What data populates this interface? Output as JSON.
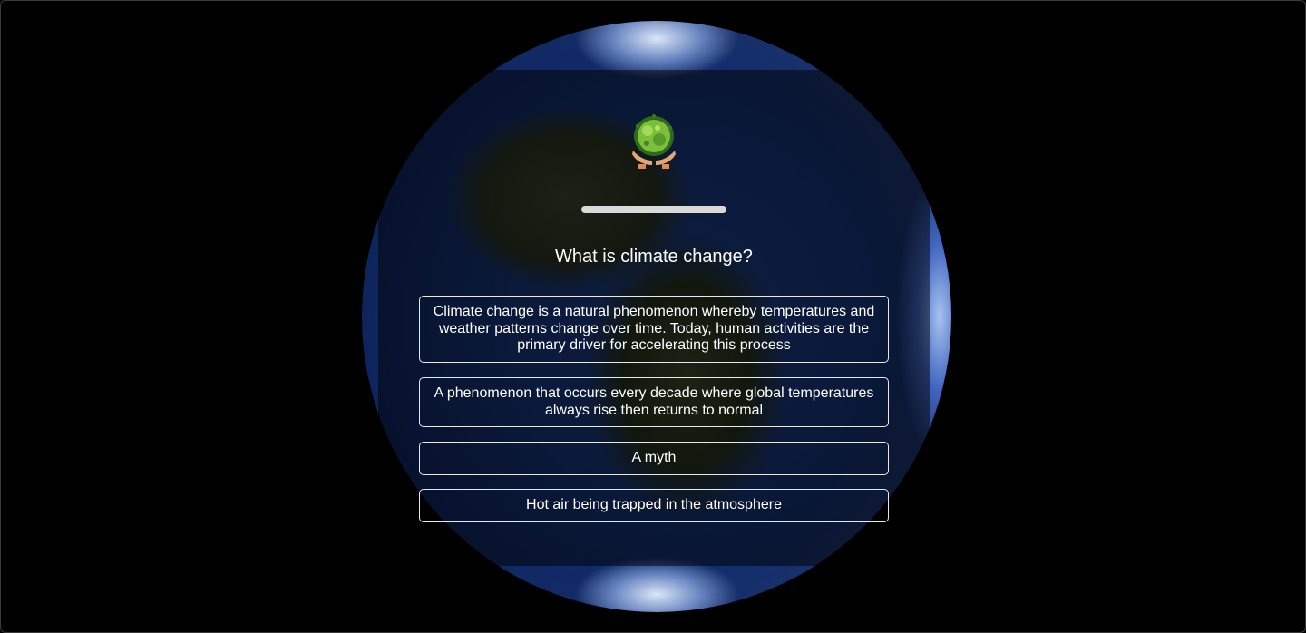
{
  "quiz": {
    "question": "What is climate change?",
    "progress_fraction": 1.0,
    "answers": [
      {
        "label": "Climate change is a natural phenomenon whereby temperatures and weather patterns change over time. Today, human activities are the primary driver for accelerating this process"
      },
      {
        "label": "A phenomenon that occurs every decade where global temperatures always rise then returns to normal"
      },
      {
        "label": "A myth"
      },
      {
        "label": "Hot air being trapped in the atmosphere"
      }
    ]
  },
  "colors": {
    "background": "#000000",
    "text": "#ffffff",
    "button_border": "#e9e9e9",
    "progress": "#e6e6e6",
    "leaf_green": "#7bbf3a",
    "hands": "#e0a878"
  },
  "icons": {
    "logo": "earth-in-hands-icon"
  }
}
